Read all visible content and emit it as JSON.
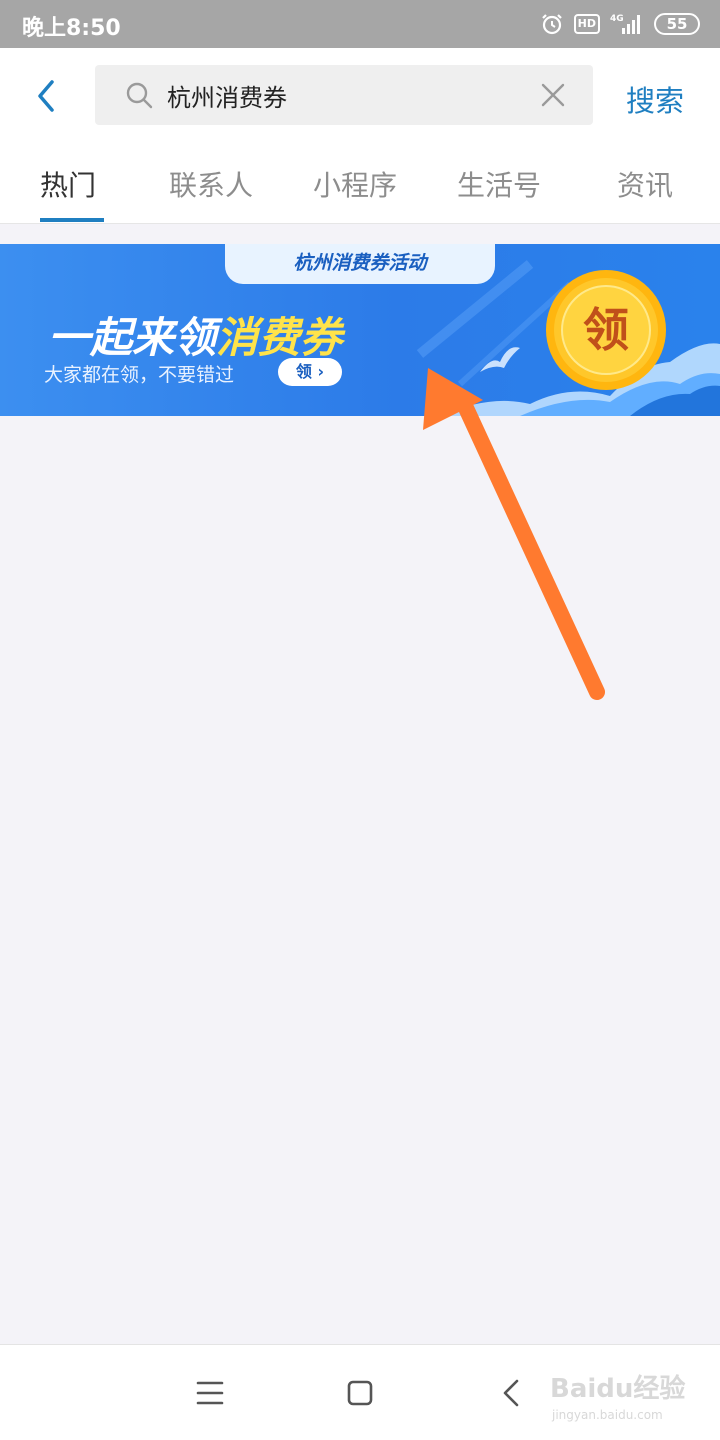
{
  "status_bar": {
    "time": "晚上8:50",
    "hd": "HD",
    "network": "4G",
    "battery": "55",
    "icons": [
      "alarm-icon",
      "signal-icon",
      "battery-icon"
    ]
  },
  "header": {
    "back_icon": "chevron-left-icon",
    "search_value": "杭州消费券",
    "search_icon": "search-icon",
    "clear_icon": "close-icon",
    "search_button": "搜索"
  },
  "tabs": [
    {
      "label": "热门",
      "active": true
    },
    {
      "label": "联系人",
      "active": false
    },
    {
      "label": "小程序",
      "active": false
    },
    {
      "label": "生活号",
      "active": false
    },
    {
      "label": "资讯",
      "active": false
    }
  ],
  "banner": {
    "tag": "杭州消费券活动",
    "title_part1": "一起来领",
    "title_part2": "消费券",
    "subtitle": "大家都在领，不要错过",
    "pill_label": "领",
    "coin_label": "领"
  },
  "nav_bar": {
    "icons": [
      "menu-icon",
      "home-square-icon",
      "back-chevron-icon"
    ]
  },
  "watermark": {
    "brand": "Baidu经验",
    "url": "jingyan.baidu.com"
  },
  "colors": {
    "accent": "#1f7fc1",
    "status_bar": "#a6a6a6",
    "banner_blue": "#2c7be8",
    "banner_yellow": "#ffe34a",
    "arrow": "#ff7a2f",
    "background": "#f4f3f8"
  }
}
